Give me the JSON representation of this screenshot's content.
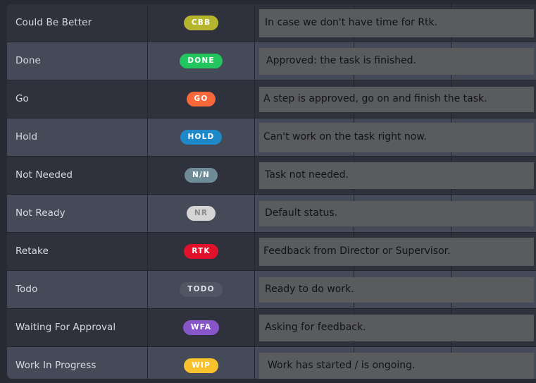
{
  "table": {
    "columns": [
      "name",
      "code",
      "description"
    ],
    "rows": [
      {
        "name": "Could Be Better",
        "code": "CBB",
        "badge_bg": "#b5b52e",
        "badge_fg": "#ffffff",
        "description": "In case we don't have time for Rtk."
      },
      {
        "name": "Done",
        "code": "DONE",
        "badge_bg": "#22c55e",
        "badge_fg": "#ffffff",
        "description": "Approved: the task is finished."
      },
      {
        "name": "Go",
        "code": "GO",
        "badge_bg": "#f9683a",
        "badge_fg": "#ffffff",
        "description": "A step is approved, go on and finish the task."
      },
      {
        "name": "Hold",
        "code": "HOLD",
        "badge_bg": "#1f88c9",
        "badge_fg": "#ffffff",
        "description": "Can't work on the task right now."
      },
      {
        "name": "Not Needed",
        "code": "N/N",
        "badge_bg": "#6e8c98",
        "badge_fg": "#ffffff",
        "description": "Task not needed."
      },
      {
        "name": "Not Ready",
        "code": "NR",
        "badge_bg": "#d5d5d5",
        "badge_fg": "#8a8a8a",
        "description": "Default status."
      },
      {
        "name": "Retake",
        "code": "RTK",
        "badge_bg": "#e1112b",
        "badge_fg": "#ffffff",
        "description": "Feedback from Director or Supervisor."
      },
      {
        "name": "Todo",
        "code": "TODO",
        "badge_bg": "#505663",
        "badge_fg": "#dde1e8",
        "description": "Ready to do work."
      },
      {
        "name": "Waiting For Approval",
        "code": "WFA",
        "badge_bg": "#8757c9",
        "badge_fg": "#ffffff",
        "description": "Asking for feedback."
      },
      {
        "name": "Work In Progress",
        "code": "WIP",
        "badge_bg": "#f7c22e",
        "badge_fg": "#ffffff",
        "description": "Work has started / is ongoing."
      }
    ]
  },
  "theme": {
    "page_bg": "#272a33",
    "row_dark": "#2f323c",
    "row_light": "#454a59",
    "grid_line": "#22252d",
    "name_text": "#d7dae1",
    "desc_box_bg": "#595b5d",
    "desc_text": "#121316"
  }
}
